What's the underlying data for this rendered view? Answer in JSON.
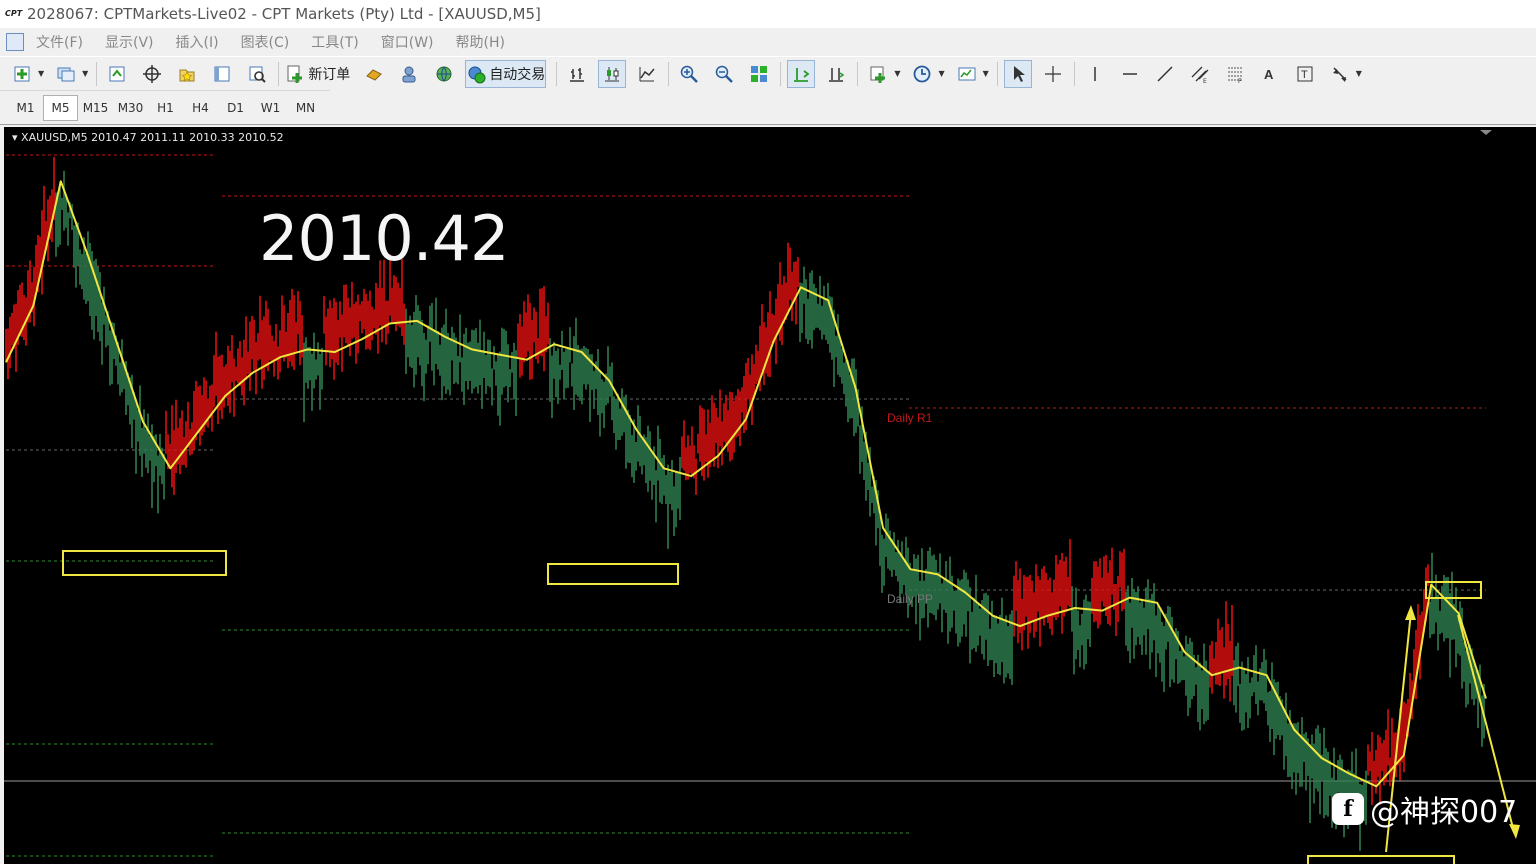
{
  "window": {
    "title": "2028067: CPTMarkets-Live02 - CPT Markets (Pty) Ltd - [XAUUSD,M5]",
    "app_icon_text": "CPT"
  },
  "menu": {
    "items": [
      "文件(F)",
      "显示(V)",
      "插入(I)",
      "图表(C)",
      "工具(T)",
      "窗口(W)",
      "帮助(H)"
    ]
  },
  "toolbar": {
    "new_order_label": "新订单",
    "auto_trade_label": "自动交易"
  },
  "timeframes": {
    "items": [
      "M1",
      "M5",
      "M15",
      "M30",
      "H1",
      "H4",
      "D1",
      "W1",
      "MN"
    ],
    "active": "M5"
  },
  "chart": {
    "symbol_info": "XAUUSD,M5  2010.47 2011.11 2010.33 2010.52",
    "big_price": "2010.42",
    "label_r1": "Daily R1",
    "label_pp": "Daily PP",
    "watermark": "@神探007",
    "colors": {
      "background": "#000000",
      "bull": "#e01010",
      "bear": "#2e7d4f",
      "ma": "#f0e640",
      "resistance_line": "#c01818",
      "support_line": "#2e8b2e",
      "pivot_line": "#666666",
      "annotation": "#f0e640"
    }
  },
  "chart_data": {
    "type": "line",
    "title": "",
    "series": [
      {
        "name": "",
        "values": [
          2010.4,
          2012.6,
          2017.4,
          2014.5,
          2011.3,
          2008.1,
          2006.3,
          2007.7,
          2009.1,
          2010.0,
          2010.6,
          2010.9,
          2010.8,
          2011.3,
          2011.9,
          2012.0,
          2011.4,
          2010.9,
          2010.7,
          2010.5,
          2011.1,
          2010.8,
          2009.7,
          2007.8,
          2006.3,
          2006.0,
          2006.8,
          2008.2,
          2011.2,
          2013.3,
          2012.8,
          2009.4,
          2004.0,
          2002.4,
          2002.2,
          2001.5,
          2000.6,
          2000.2,
          2000.6,
          2000.9,
          2000.8,
          2001.3,
          2001.1,
          1999.2,
          1998.3,
          1998.6,
          1998.3,
          1996.2,
          1995.1,
          1994.5,
          1994.0,
          1995.2,
          2001.8,
          2000.7,
          1997.4
        ]
      }
    ]
  }
}
